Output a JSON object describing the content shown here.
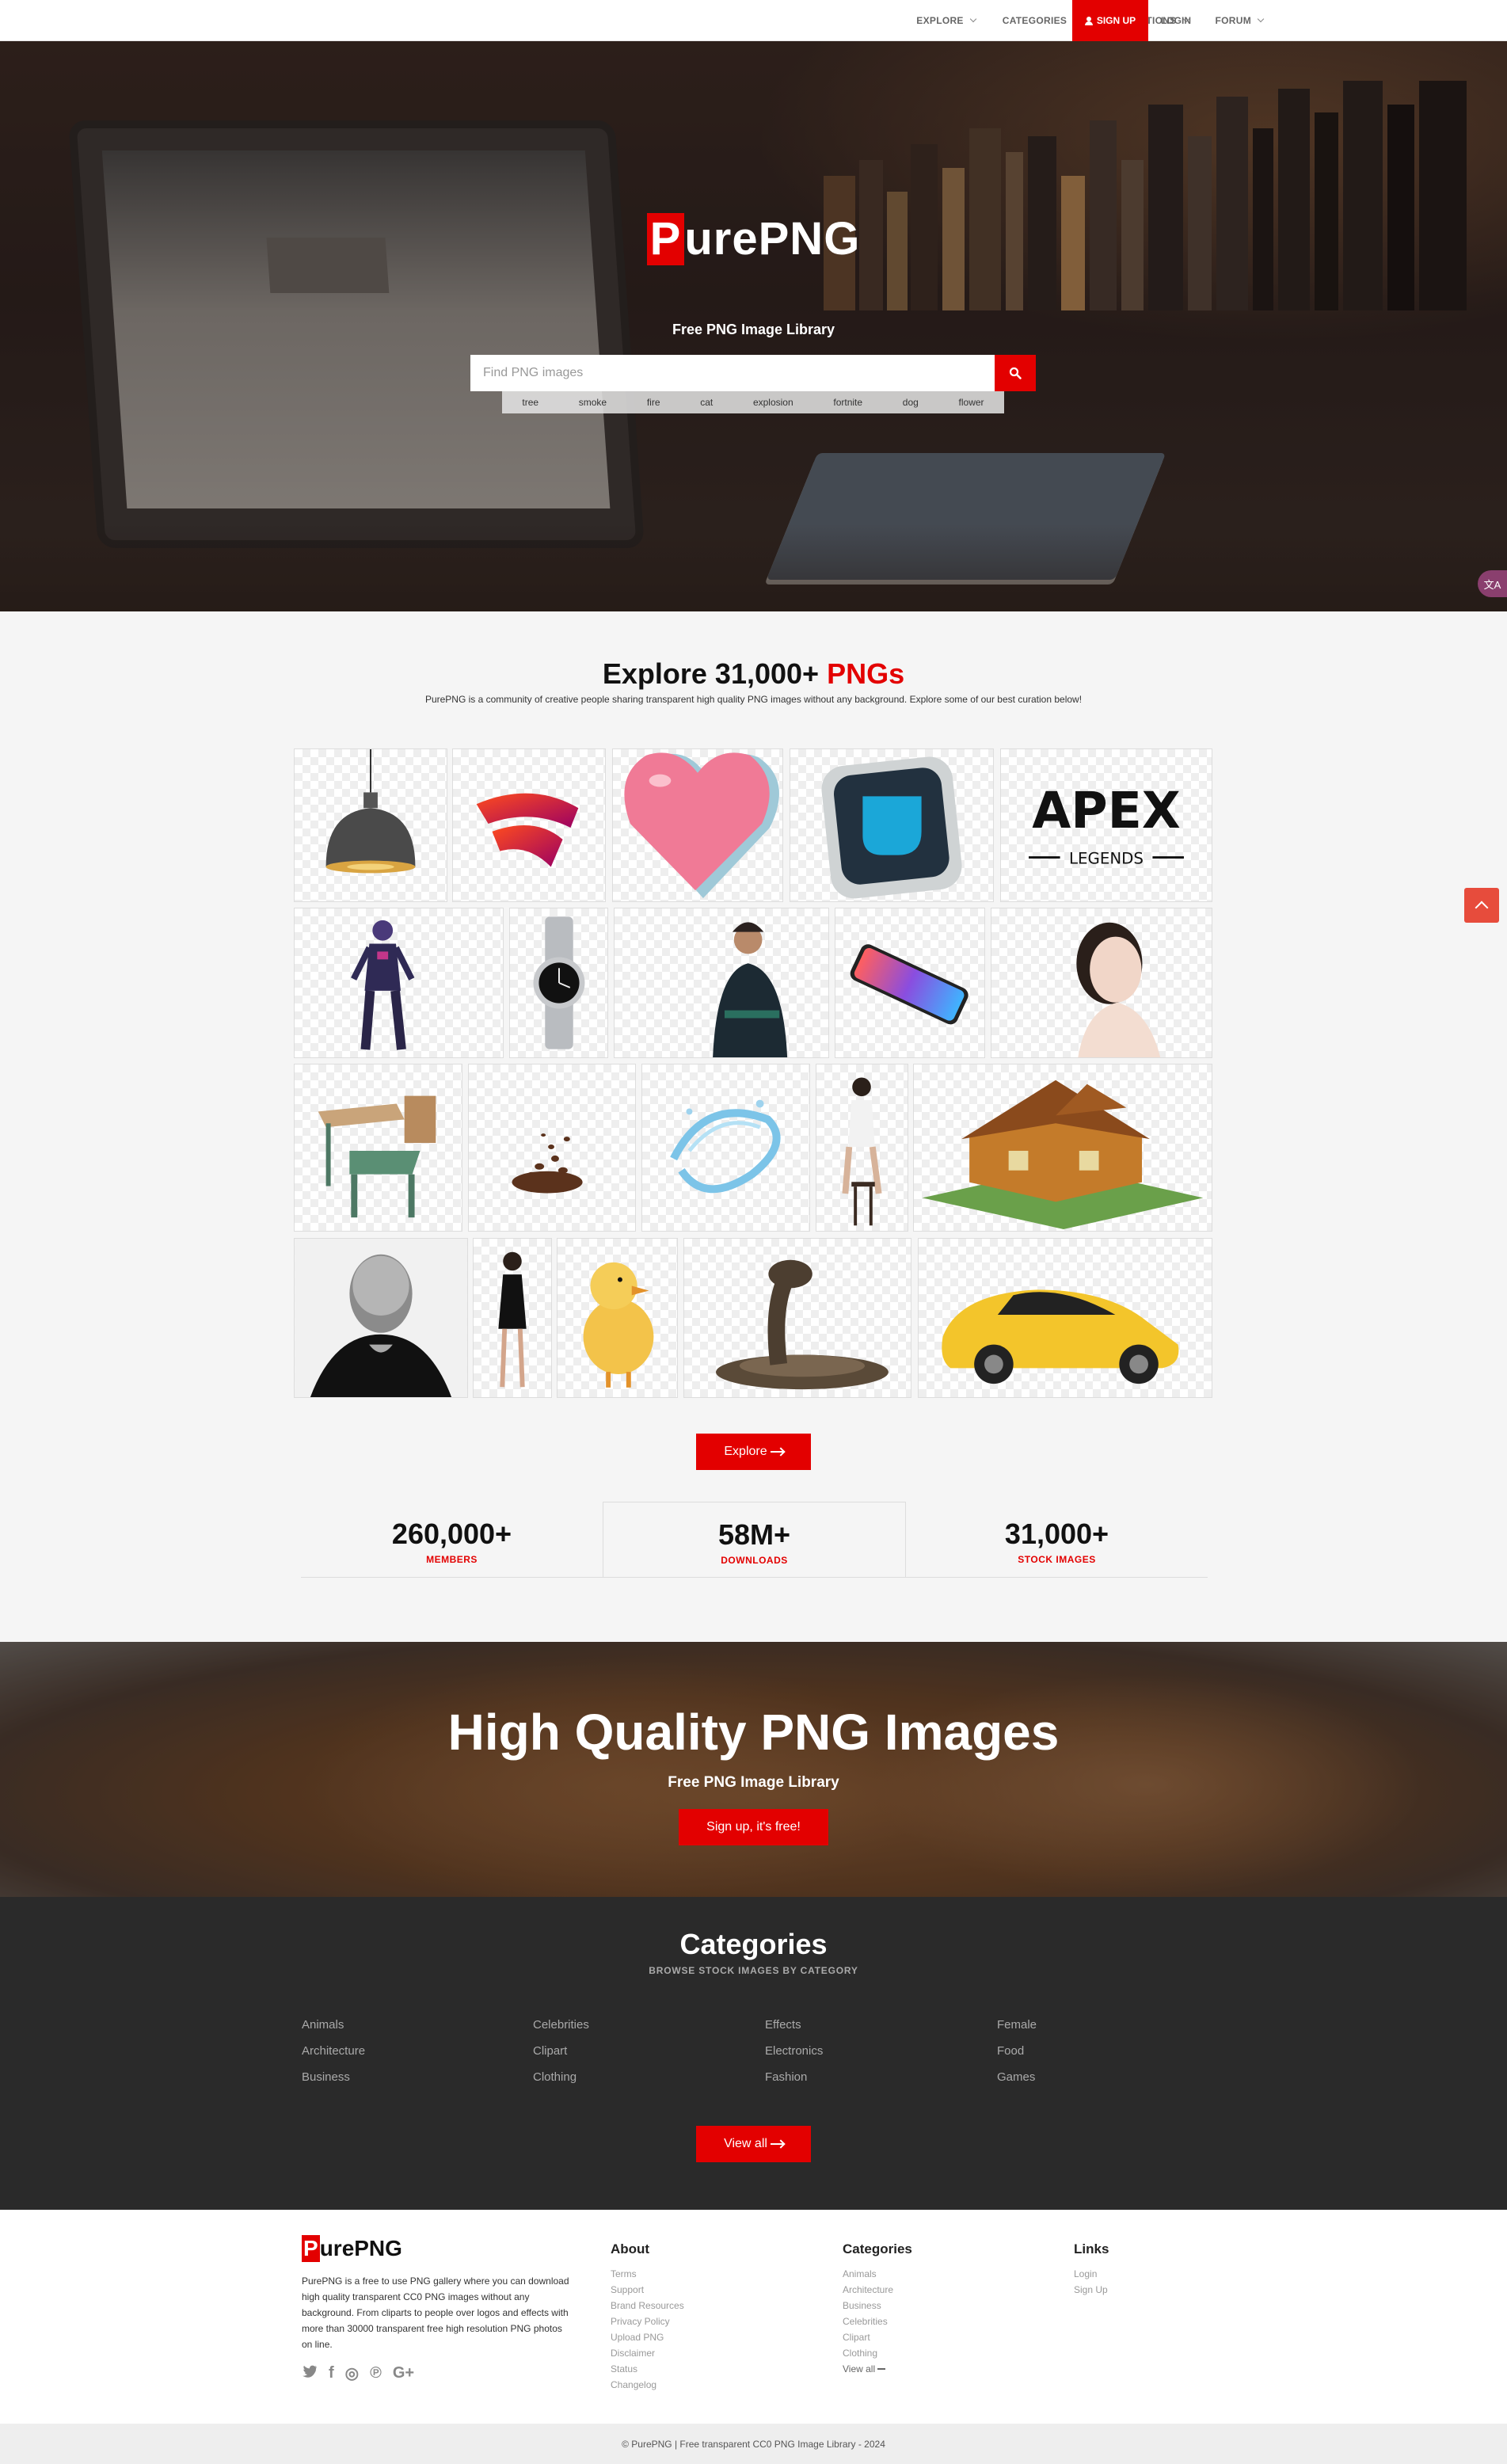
{
  "nav": {
    "items": [
      {
        "label": "EXPLORE"
      },
      {
        "label": "CATEGORIES"
      },
      {
        "label": "COLLECTIONS"
      },
      {
        "label": "FORUM"
      }
    ],
    "signup_label": "SIGN UP",
    "login_label": "LOGIN"
  },
  "hero": {
    "logo_p": "P",
    "logo_rest": "urePNG",
    "tagline": "Free PNG Image Library",
    "search_placeholder": "Find PNG images",
    "tags": [
      "tree",
      "smoke",
      "fire",
      "cat",
      "explosion",
      "fortnite",
      "dog",
      "flower"
    ],
    "side_pill": "文A"
  },
  "explore": {
    "title_main": "Explore 31,000+ ",
    "title_accent": "PNGs",
    "subtitle": "PurePNG is a community of creative people sharing transparent high quality PNG images without any background. Explore some of our best curation below!",
    "tiles": [
      {
        "icon": "pendant-lamp"
      },
      {
        "icon": "stadia-logo"
      },
      {
        "icon": "pink-heart"
      },
      {
        "icon": "pewdiepie-fist-logo"
      },
      {
        "icon": "apex-legends-logo",
        "text_main": "APEX",
        "text_sub": "LEGENDS"
      },
      {
        "icon": "fortnite-character"
      },
      {
        "icon": "rolex-watch"
      },
      {
        "icon": "football-coach"
      },
      {
        "icon": "iphone-x"
      },
      {
        "icon": "woman-portrait"
      },
      {
        "icon": "school-desk"
      },
      {
        "icon": "coffee-beans"
      },
      {
        "icon": "water-splash"
      },
      {
        "icon": "model-on-stool"
      },
      {
        "icon": "wooden-house"
      },
      {
        "icon": "steve-jobs"
      },
      {
        "icon": "woman-black-dress"
      },
      {
        "icon": "duckling"
      },
      {
        "icon": "cobra-snake"
      },
      {
        "icon": "yellow-sports-car"
      }
    ],
    "button_label": "Explore"
  },
  "stats": [
    {
      "value": "260,000+",
      "label": "MEMBERS"
    },
    {
      "value": "58M+",
      "label": "DOWNLOADS"
    },
    {
      "value": "31,000+",
      "label": "STOCK IMAGES"
    }
  ],
  "banner": {
    "title": "High Quality PNG Images",
    "subtitle": "Free PNG Image Library",
    "button_label": "Sign up, it's free!"
  },
  "categories": {
    "title": "Categories",
    "subtitle": "BROWSE STOCK IMAGES BY CATEGORY",
    "columns": [
      [
        "Animals",
        "Architecture",
        "Business"
      ],
      [
        "Celebrities",
        "Clipart",
        "Clothing"
      ],
      [
        "Effects",
        "Electronics",
        "Fashion"
      ],
      [
        "Female",
        "Food",
        "Games"
      ]
    ],
    "button_label": "View all"
  },
  "footer": {
    "logo_p": "P",
    "logo_rest": "urePNG",
    "description": "PurePNG is a free to use PNG gallery where you can download high quality transparent CC0 PNG images without any background. From cliparts to people over logos and effects with more than 30000 transparent free high resolution PNG photos on line.",
    "social": [
      {
        "icon": "twitter-icon",
        "glyph": "🐦"
      },
      {
        "icon": "facebook-icon",
        "glyph": "f"
      },
      {
        "icon": "instagram-icon",
        "glyph": "◎"
      },
      {
        "icon": "pinterest-icon",
        "glyph": "℗"
      },
      {
        "icon": "google-plus-icon",
        "glyph": "G+"
      }
    ],
    "about": {
      "title": "About",
      "links": [
        "Terms",
        "Support",
        "Brand Resources",
        "Privacy Policy",
        "Upload PNG",
        "Disclaimer",
        "Status",
        "Changelog"
      ]
    },
    "categories": {
      "title": "Categories",
      "links": [
        "Animals",
        "Architecture",
        "Business",
        "Celebrities",
        "Clipart",
        "Clothing",
        "View all"
      ]
    },
    "links": {
      "title": "Links",
      "links": [
        "Login",
        "Sign Up"
      ]
    },
    "copyright": "© PurePNG | Free transparent CC0 PNG Image Library - 2024"
  },
  "colors": {
    "brand_red": "#e30000",
    "dark": "#2a2a2a",
    "backtop": "#e74c3c"
  }
}
